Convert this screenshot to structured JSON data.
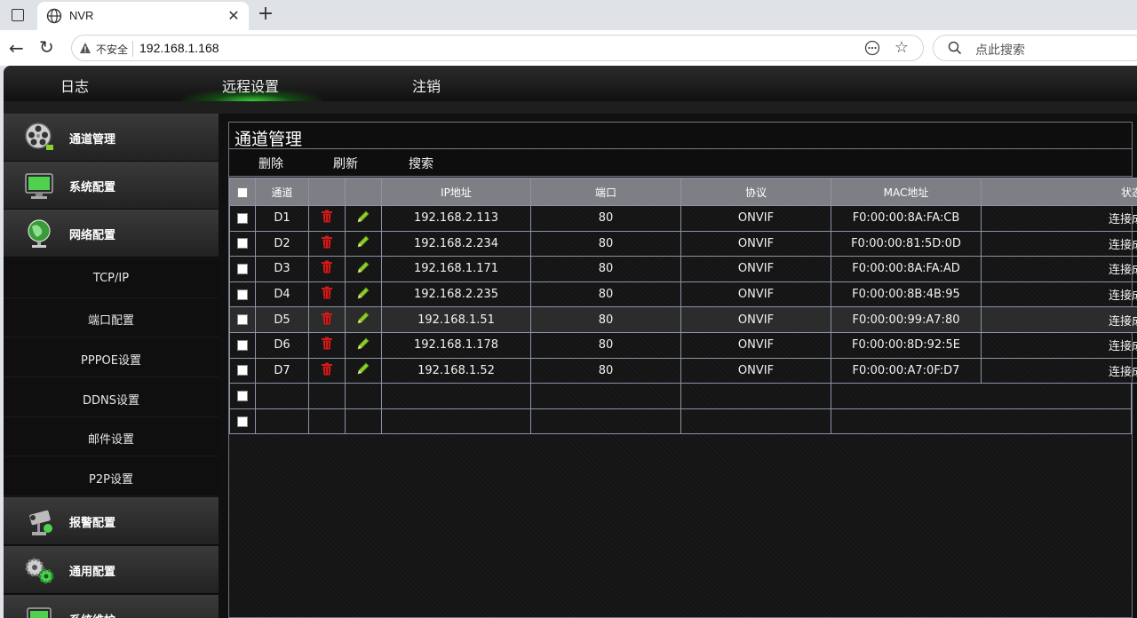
{
  "browser": {
    "tab_title": "NVR",
    "insecure_label": "不安全",
    "url": "192.168.1.168",
    "search_placeholder": "点此搜索"
  },
  "topnav": {
    "items": [
      "日志",
      "远程设置",
      "注销"
    ],
    "active_index": 1
  },
  "sidebar": {
    "categories": [
      {
        "label": "通道管理",
        "icon": "film-reel-icon"
      },
      {
        "label": "系统配置",
        "icon": "monitor-icon"
      },
      {
        "label": "网络配置",
        "icon": "globe-icon"
      }
    ],
    "sub_items": [
      "TCP/IP",
      "端口配置",
      "PPPOE设置",
      "DDNS设置",
      "邮件设置",
      "P2P设置"
    ],
    "categories_bottom": [
      {
        "label": "报警配置",
        "icon": "alarm-camera-icon"
      },
      {
        "label": "通用配置",
        "icon": "gears-icon"
      },
      {
        "label": "系统维护",
        "icon": "maintenance-icon"
      }
    ]
  },
  "panel": {
    "title": "通道管理",
    "toolbar": {
      "delete": "删除",
      "refresh": "刷新",
      "search": "搜索"
    }
  },
  "table": {
    "headers": [
      "通道",
      "IP地址",
      "端口",
      "协议",
      "MAC地址",
      "状态"
    ],
    "rows": [
      {
        "channel": "D1",
        "ip": "192.168.2.113",
        "port": "80",
        "protocol": "ONVIF",
        "mac": "F0:00:00:8A:FA:CB",
        "status": "连接成功"
      },
      {
        "channel": "D2",
        "ip": "192.168.2.234",
        "port": "80",
        "protocol": "ONVIF",
        "mac": "F0:00:00:81:5D:0D",
        "status": "连接成功"
      },
      {
        "channel": "D3",
        "ip": "192.168.1.171",
        "port": "80",
        "protocol": "ONVIF",
        "mac": "F0:00:00:8A:FA:AD",
        "status": "连接成功"
      },
      {
        "channel": "D4",
        "ip": "192.168.2.235",
        "port": "80",
        "protocol": "ONVIF",
        "mac": "F0:00:00:8B:4B:95",
        "status": "连接成功"
      },
      {
        "channel": "D5",
        "ip": "192.168.1.51",
        "port": "80",
        "protocol": "ONVIF",
        "mac": "F0:00:00:99:A7:80",
        "status": "连接成功"
      },
      {
        "channel": "D6",
        "ip": "192.168.1.178",
        "port": "80",
        "protocol": "ONVIF",
        "mac": "F0:00:00:8D:92:5E",
        "status": "连接成功"
      },
      {
        "channel": "D7",
        "ip": "192.168.1.52",
        "port": "80",
        "protocol": "ONVIF",
        "mac": "F0:00:00:A7:0F:D7",
        "status": "连接成功"
      }
    ],
    "highlighted_row": 4,
    "empty_rows": 2
  },
  "colors": {
    "accent_green": "#3cdc3c",
    "delete_red": "#d11a1a",
    "edit_green": "#8ccf2a"
  }
}
